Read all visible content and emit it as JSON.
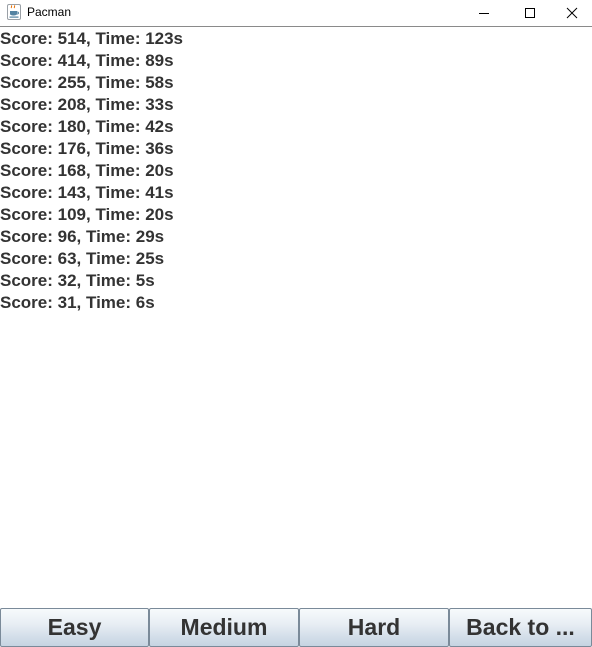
{
  "window": {
    "title": "Pacman",
    "app_icon": "java-cup-icon",
    "controls": {
      "minimize_icon": "minimize-icon",
      "maximize_icon": "maximize-icon",
      "close_icon": "close-icon"
    }
  },
  "scores": [
    "Score: 514, Time: 123s",
    "Score: 414, Time: 89s",
    "Score: 255, Time: 58s",
    "Score: 208, Time: 33s",
    "Score: 180, Time: 42s",
    "Score: 176, Time: 36s",
    "Score: 168, Time: 20s",
    "Score: 143, Time: 41s",
    "Score: 109, Time: 20s",
    "Score: 96, Time: 29s",
    "Score: 63, Time: 25s",
    "Score: 32, Time: 5s",
    "Score: 31, Time: 6s"
  ],
  "buttons": {
    "easy": "Easy",
    "medium": "Medium",
    "hard": "Hard",
    "back": "Back to ..."
  },
  "colors": {
    "text": "#333333",
    "background": "#ffffff",
    "button_border": "#7a8a99",
    "button_gradient_top": "#f7fafc",
    "button_gradient_bottom": "#c6d4e2"
  }
}
